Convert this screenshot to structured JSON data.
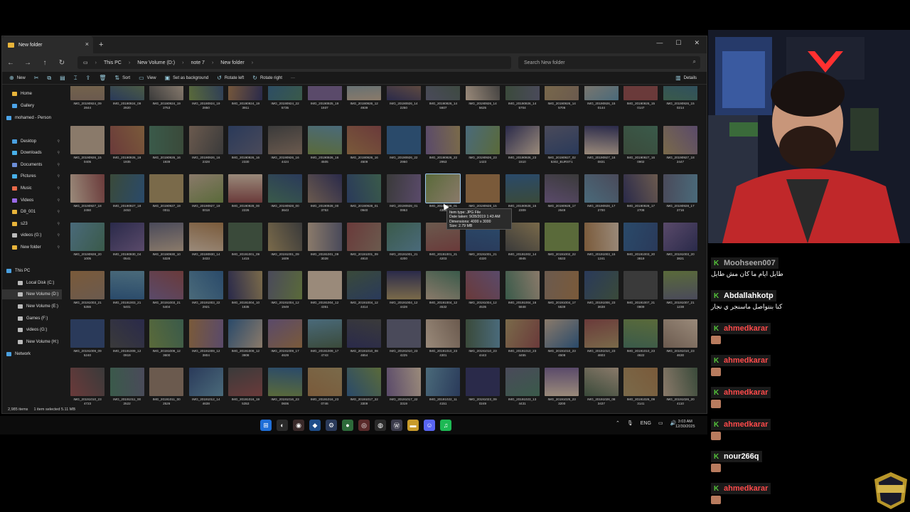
{
  "window": {
    "tab_title": "New folder",
    "close": "×",
    "new_tab": "+",
    "min": "—",
    "max": "☐",
    "win_close": "✕"
  },
  "address": {
    "crumbs": [
      "This PC",
      "New Volume (D:)",
      "note 7",
      "New folder"
    ],
    "search_placeholder": "Search New folder"
  },
  "toolbar": {
    "new": "New",
    "sort": "Sort",
    "view": "View",
    "set_bg": "Set as background",
    "rotate_left": "Rotate left",
    "rotate_right": "Rotate right",
    "more": "···",
    "details": "Details"
  },
  "sidebar": [
    {
      "label": "Home",
      "color": "#e8b43a"
    },
    {
      "label": "Gallery",
      "color": "#4ca4e8"
    },
    {
      "label": "mohamed - Person",
      "color": "#4ca4e8"
    },
    {
      "label": "Desktop",
      "color": "#4aa0e0"
    },
    {
      "label": "Downloads",
      "color": "#48b0e8"
    },
    {
      "label": "Documents",
      "color": "#6c8ed8"
    },
    {
      "label": "Pictures",
      "color": "#48b0e8"
    },
    {
      "label": "Music",
      "color": "#e86a4a"
    },
    {
      "label": "Videos",
      "color": "#9a6ae8"
    },
    {
      "label": "D8_001",
      "color": "#e8b43a"
    },
    {
      "label": "s23",
      "color": "#e8b43a"
    },
    {
      "label": "videos (G:)",
      "color": "#bbbbbb"
    },
    {
      "label": "New folder",
      "color": "#e8b43a"
    },
    {
      "label": "This PC",
      "color": "#4aa0e0"
    },
    {
      "label": "Local Disk (C:)",
      "color": "#bbbbbb"
    },
    {
      "label": "New Volume (D:)",
      "color": "#bbbbbb"
    },
    {
      "label": "New Volume (E:)",
      "color": "#bbbbbb"
    },
    {
      "label": "Games (F:)",
      "color": "#bbbbbb"
    },
    {
      "label": "videos (G:)",
      "color": "#bbbbbb"
    },
    {
      "label": "New Volume (H:)",
      "color": "#bbbbbb"
    },
    {
      "label": "Network",
      "color": "#4aa0e0"
    }
  ],
  "files": [
    [
      "IMG_20190924_09\n2844",
      "IMG_20190924_09\n2920",
      "IMG_20190924_19\n2753",
      "IMG_20190924_19\n2850",
      "IMG_20190924_19\n3911",
      "IMG_20190924_22\n5735",
      "IMG_20190925_19\n1937",
      "IMG_20190926_12\n4939",
      "IMG_20190926_14\n2250",
      "IMG_20190926_14\n5607",
      "IMG_20190926_14\n5625",
      "IMG_20190926_14\n5704",
      "IMG_20190926_14\n5706",
      "IMG_20190926_15\n0144",
      "IMG_20190926_15\n0147",
      "IMG_20190926_15\n0214"
    ],
    [
      "IMG_20190926_15\n0405",
      "IMG_20190926_16\n1935",
      "IMG_20190926_16\n1939",
      "IMG_20190926_16\n2328",
      "IMG_20190926_16\n2330",
      "IMG_20190926_16\n4424",
      "IMG_20190926_16\n4505",
      "IMG_20190926_16\n4509",
      "IMG_20190926_22\n2950",
      "IMG_20190926_22\n2953",
      "IMG_20190926_23\n1423",
      "IMG_20190926_23\n1510",
      "IMG_20190927_02\n5302_BURST1",
      "IMG_20190927_16\n0831",
      "IMG_20190927_16\n0902",
      "IMG_20190927_18\n2447"
    ],
    [
      "IMG_20190927_18\n2450",
      "IMG_20190927_18\n2453",
      "IMG_20190927_19\n0011",
      "IMG_20190927_19\n0018",
      "IMG_20190928_00\n2226",
      "IMG_20190928_00\n3643",
      "IMG_20190928_00\n3753",
      "IMG_20190928_01\n0940",
      "IMG_20190928_01\n0953",
      "IMG_20190928_01\n4300",
      "IMG_20190928_15\n2239",
      "IMG_20190928_15\n2309",
      "IMG_20190928_17\n2649",
      "IMG_20190928_17\n2700",
      "IMG_20190928_17\n2708",
      "IMG_20190928_17\n2716"
    ],
    [
      "IMG_20190928_20\n1005",
      "IMG_20190930_04\n0541",
      "IMG_20190930_10\n5328",
      "IMG_20190930_14\n3433",
      "IMG_20191001_09\n1415",
      "IMG_20191001_09\n1609",
      "IMG_20191001_09\n3028",
      "IMG_20191001_09\n4910",
      "IMG_20191001_21\n4200",
      "IMG_20191001_21\n4203",
      "IMG_20191001_21\n4320",
      "IMG_20191002_14\n4945",
      "IMG_20191002_22\n5533",
      "IMG_20191003_15\n1241",
      "IMG_20191003_20\n3819",
      "IMG_20191003_20\n3821"
    ],
    [
      "IMG_20191003_21\n5355",
      "IMG_20191003_21\n5401",
      "IMG_20191003_21\n5404",
      "IMG_20191003_22\n2921",
      "IMG_20191004_10\n1835",
      "IMG_20191004_12\n1949",
      "IMG_20191004_12\n4351",
      "IMG_20191004_12\n4414",
      "IMG_20191004_12\n4428",
      "IMG_20191004_12\n4532",
      "IMG_20191004_12\n4535",
      "IMG_20191004_16\n5848",
      "IMG_20191004_17\n5539",
      "IMG_20191006_23\n3638",
      "IMG_20191007_21\n0809",
      "IMG_20191007_21\n1238"
    ],
    [
      "IMG_20191009_09\n5240",
      "IMG_20191009_12\n0919",
      "IMG_20191009_12\n3600",
      "IMG_20191009_12\n3804",
      "IMG_20191009_12\n3808",
      "IMG_20191009_17\n4629",
      "IMG_20191009_17\n4743",
      "IMG_20191010_08\n4654",
      "IMG_20191010_23\n4225",
      "IMG_20191010_23\n4301",
      "IMG_20191010_23\n4443",
      "IMG_20191010_23\n4455",
      "IMG_20191010_23\n4508",
      "IMG_20191010_23\n4603",
      "IMG_20191010_23\n4622",
      "IMG_20191010_23\n4630"
    ],
    [
      "IMG_20191010_23\n4723",
      "IMG_20191011_00\n2522",
      "IMG_20191011_00\n2526",
      "IMG_20191012_14\n4638",
      "IMG_20191016_19\n5353",
      "IMG_20191016_23\n0606",
      "IMG_20191016_23\n0746",
      "IMG_20191017_22\n3309",
      "IMG_20191017_22\n3319",
      "IMG_20191022_11\n4151",
      "IMG_20191023_09\n0249",
      "IMG_20191023_13\n4431",
      "IMG_20191025_23\n3200",
      "IMG_20191026_08\n3437",
      "IMG_20191026_09\n3141",
      "IMG_20191026_20\n4110"
    ]
  ],
  "tooltip": {
    "line1": "Item type: JPG File",
    "line2": "Date taken: 9/28/2019 1:43 AM",
    "line3": "Dimensions: 4000 x 3000",
    "line4": "Size: 2.79 MB"
  },
  "status": {
    "count": "2,985 items",
    "selected": "1 item selected  5.11 MB"
  },
  "taskbar": {
    "tray_lang": "ENG",
    "time": "3:03 AM",
    "date": "12/30/2025"
  },
  "chat": [
    {
      "user": "Moohseen007",
      "text": "طايل ايام ما كان مش طايل",
      "emote": false
    },
    {
      "user": "Abdallahkotp",
      "text": "كنا بنتواصل ماسنجر ي نجار",
      "emote": false
    },
    {
      "user": "ahmedkarar",
      "text": "",
      "emote": true
    },
    {
      "user": "ahmedkarar",
      "text": "",
      "emote": true
    },
    {
      "user": "ahmedkarar",
      "text": "",
      "emote": true
    },
    {
      "user": "ahmedkarar",
      "text": "",
      "emote": true
    },
    {
      "user": "nour266q",
      "text": "",
      "emote": true
    },
    {
      "user": "ahmedkarar",
      "text": "",
      "emote": true
    }
  ],
  "chat_colors": {
    "Moohseen007": "#a9a9a9",
    "Abdallahkotp": "#ffffff",
    "ahmedkarar": "#ff4a4a",
    "nour266q": "#ffffff"
  },
  "thumb_palette": [
    "#6b5a4e",
    "#3a4a3a",
    "#5a4a6a",
    "#2a3a5a",
    "#7a6a4a",
    "#4a6a7a",
    "#3a3a3a",
    "#8a7a6a",
    "#2a2a4a",
    "#5a6a3a",
    "#6a3a3a",
    "#4a4a5a",
    "#7a5a3a",
    "#3a5a4a",
    "#9a8a7a",
    "#2a4a6a"
  ]
}
